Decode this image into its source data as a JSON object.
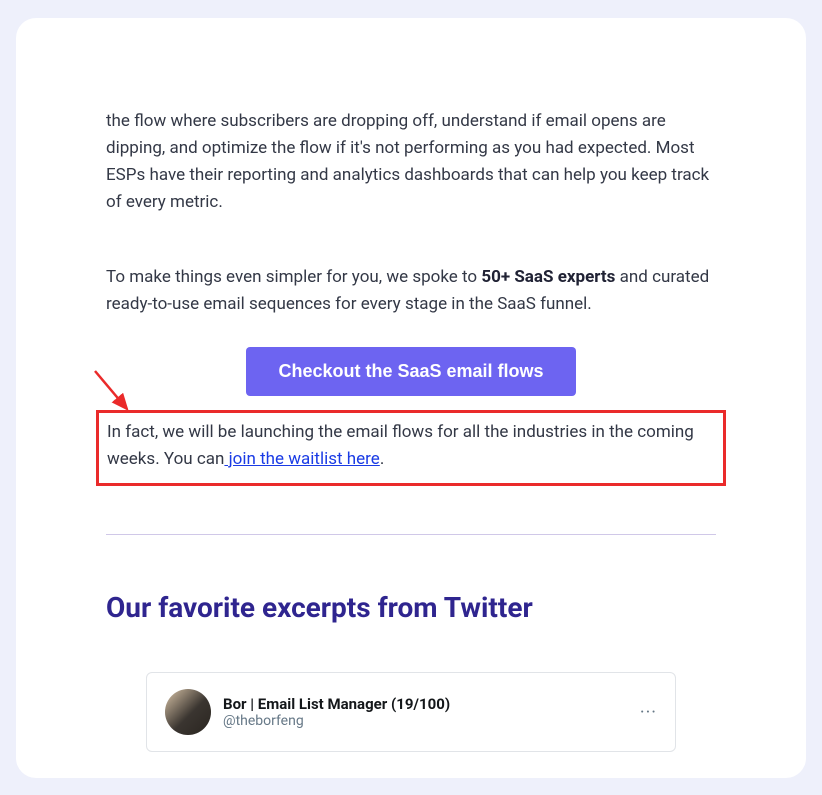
{
  "paragraph1": "the flow where subscribers are dropping off, understand if email opens are dipping, and optimize the flow if it's not performing as you had expected. Most ESPs have their reporting and analytics dashboards that can help you keep track of every metric.",
  "paragraph2_pre": "To make things even simpler for you, we spoke to ",
  "paragraph2_bold": "50+ SaaS experts",
  "paragraph2_post": " and curated ready-to-use email sequences for every stage in the SaaS funnel.",
  "cta_label": "Checkout the SaaS email flows",
  "highlight_pre": "In fact, we will be launching the email flows for all the industries in the coming weeks. You can",
  "highlight_link": " join the waitlist here",
  "highlight_post": ".",
  "section_heading": "Our favorite excerpts from Twitter",
  "tweet": {
    "name": "Bor | Email List Manager (19/100)",
    "handle": "@theborfeng",
    "dots": "···"
  }
}
